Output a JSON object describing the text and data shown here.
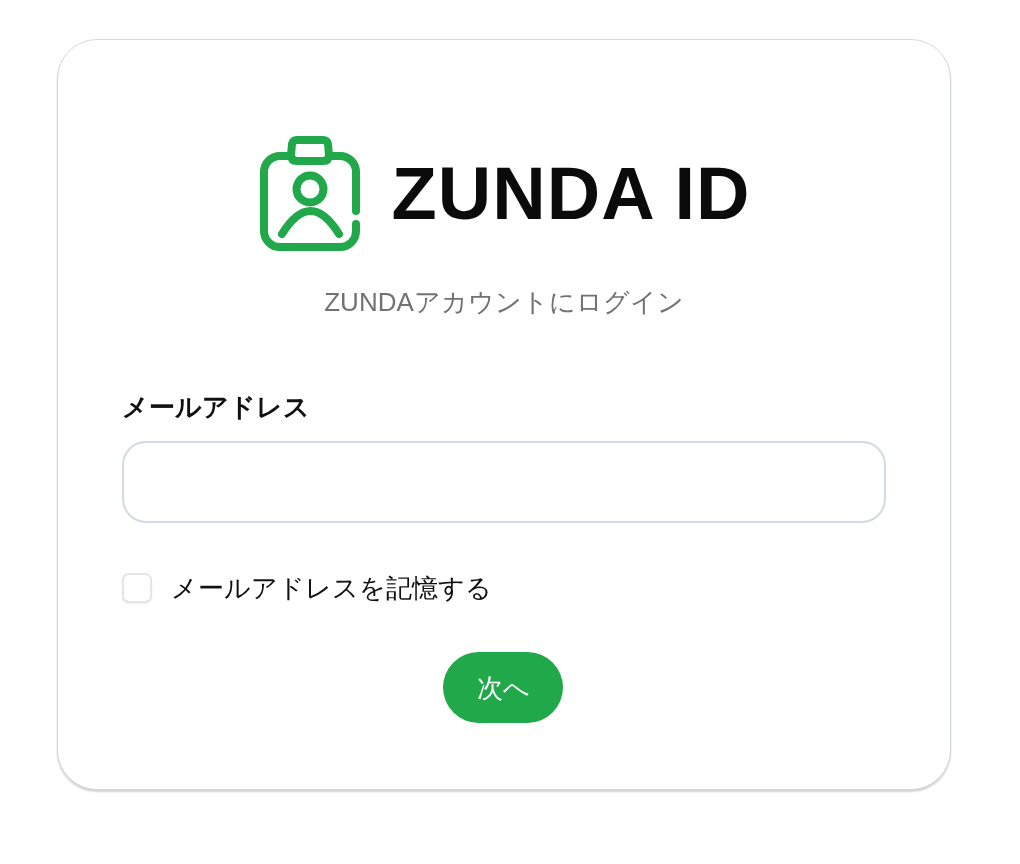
{
  "logo": {
    "text": "ZUNDA ID"
  },
  "subtitle": "ZUNDAアカウントにログイン",
  "email": {
    "label": "メールアドレス"
  },
  "remember": {
    "label": "メールアドレスを記憶する",
    "checked": false
  },
  "next_button": {
    "label": "次へ"
  }
}
